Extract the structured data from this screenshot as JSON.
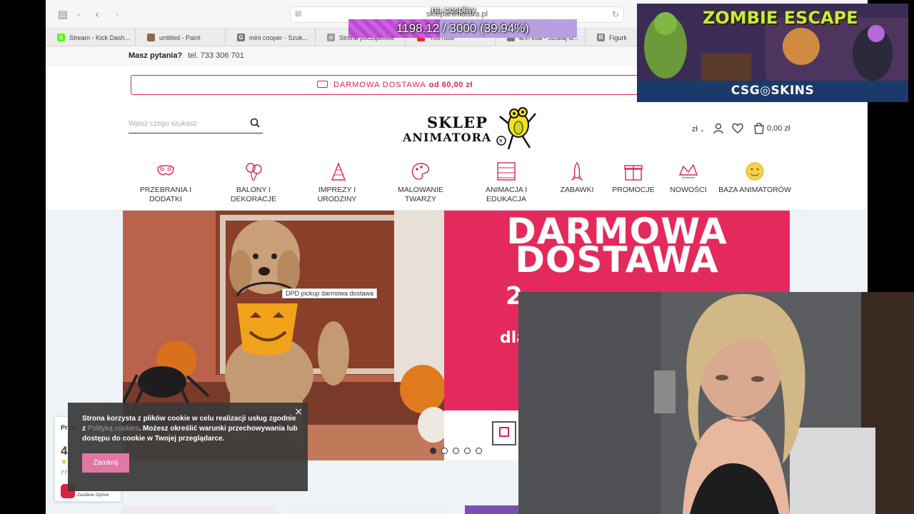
{
  "browser": {
    "url": "sklepanimatora.pl",
    "tabs": [
      {
        "label": "Stream - Kick Dash...",
        "fav_color": "#53fc18",
        "fav_char": "K"
      },
      {
        "label": "untitled - Paint",
        "fav_color": "#8a6a4a",
        "fav_char": ""
      },
      {
        "label": "mini cooper - Szuk...",
        "fav_color": "#777777",
        "fav_char": "G"
      },
      {
        "label": "Strona początkowa",
        "fav_color": "#999999",
        "fav_char": "☆"
      },
      {
        "label": "YouTube",
        "fav_color": "#e52d27",
        "fav_char": ""
      },
      {
        "label": "ann kua - Szukaj w...",
        "fav_color": "#777777",
        "fav_char": ""
      },
      {
        "label": "Figurk",
        "fav_color": "#888888",
        "fav_char": "R"
      }
    ]
  },
  "shop": {
    "topbar": {
      "question": "Masz pytania?",
      "phone": "tel. 733 306 701"
    },
    "shipping_banner": {
      "text": "DARMOWA DOSTAWA",
      "highlight": "od 60,00 zł"
    },
    "search": {
      "placeholder": "Wpisz czego szukasz"
    },
    "logo": {
      "line1": "SKLEP",
      "line2": "ANIMATORA"
    },
    "header": {
      "currency": "zł",
      "cart_total": "0,00 zł"
    },
    "nav": [
      {
        "label": "PRZEBRANIA I DODATKI",
        "icon": "mask-icon"
      },
      {
        "label": "BALONY I DEKORACJE",
        "icon": "balloons-icon"
      },
      {
        "label": "IMPREZY I URODZINY",
        "icon": "party-hat-icon"
      },
      {
        "label": "MALOWANIE TWARZY",
        "icon": "palette-icon"
      },
      {
        "label": "ANIMACJA I EDUKACJA",
        "icon": "abacus-icon"
      },
      {
        "label": "ZABAWKI",
        "icon": "rocket-icon"
      },
      {
        "label": "PROMOCJE",
        "icon": "gift-icon"
      },
      {
        "label": "NOWOŚCI",
        "icon": "new-icon"
      },
      {
        "label": "BAZA ANIMATORÓW",
        "icon": "smiley-icon"
      }
    ],
    "hero": {
      "line1": "DARMOWA",
      "line2": "DOSTAWA",
      "line3_partial": "2",
      "line4_partial": "dla"
    },
    "slider_dots": 5,
    "slider_active": 0,
    "tooltip": "DPD pickup darmowa dostawa",
    "reviews": {
      "title": "Pr op",
      "score": "4.",
      "stars": "★★",
      "count": "77",
      "brand": "Zaufane Opinie"
    },
    "cookie": {
      "text_part1": "Strona korzysta z plików cookie w celu realizacji usług zgodnie z",
      "link": "Polityką cookies",
      "text_part2": ". Możesz określić warunki przechowywania lub dostępu do cookie w Twojej przeglądarce.",
      "button": "Zamknij",
      "close": "×"
    }
  },
  "stream_overlay": {
    "goal_label": "na cosplay",
    "progress_text": "1198.12 / 3000 (39.94%)",
    "progress_fraction": 0.3994,
    "ad": {
      "title": "ZOMBIE ESCAPE",
      "brand": "CSG◎SKINS"
    }
  },
  "colors": {
    "accent": "#d8245a",
    "hero_pink": "#e42a5c",
    "cookie_button": "#e178a2",
    "progress": "#c45fe0"
  }
}
